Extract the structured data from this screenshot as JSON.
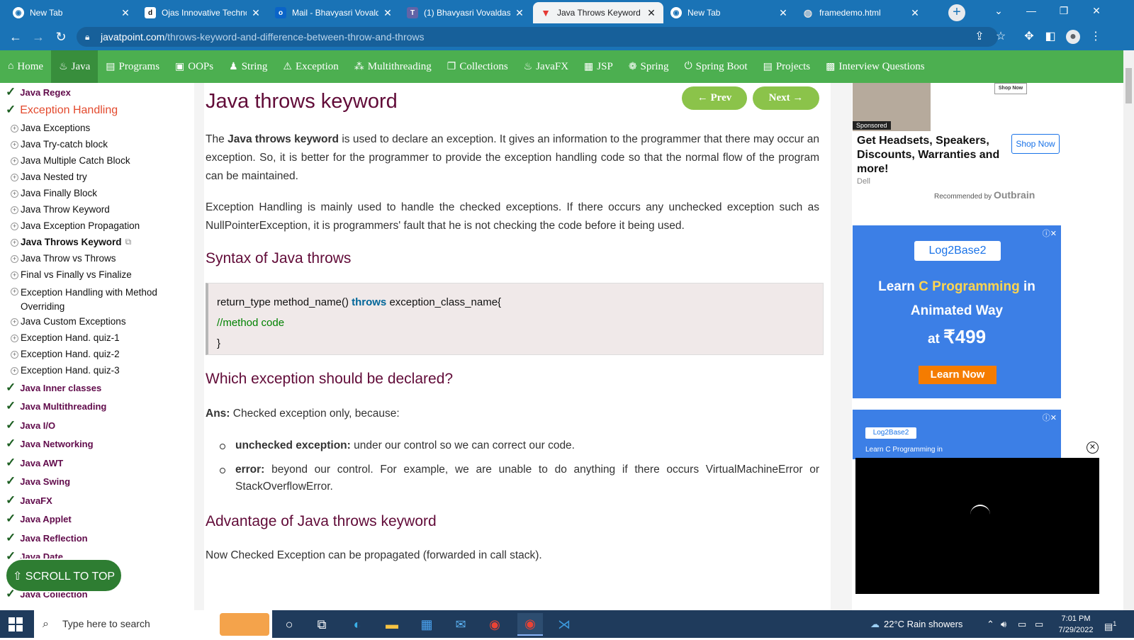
{
  "browser": {
    "tabs": [
      {
        "title": "New Tab",
        "icon": "chrome-icon"
      },
      {
        "title": "Ojas Innovative Technol",
        "icon": "d-icon"
      },
      {
        "title": "Mail - Bhavyasri Vovald",
        "icon": "outlook-icon"
      },
      {
        "title": "(1) Bhavyasri Vovaldas (",
        "icon": "teams-icon"
      },
      {
        "title": "Java Throws Keyword -",
        "icon": "javatpoint-icon"
      },
      {
        "title": "New Tab",
        "icon": "chrome-icon"
      },
      {
        "title": "framedemo.html",
        "icon": "globe-icon"
      }
    ],
    "url_domain": "javatpoint.com",
    "url_path": "/throws-keyword-and-difference-between-throw-and-throws"
  },
  "nav": {
    "items": [
      {
        "label": "Home",
        "icon": "home-icon"
      },
      {
        "label": "Java",
        "icon": "java-icon"
      },
      {
        "label": "Programs",
        "icon": "programs-icon"
      },
      {
        "label": "OOPs",
        "icon": "oops-icon"
      },
      {
        "label": "String",
        "icon": "string-icon"
      },
      {
        "label": "Exception",
        "icon": "warning-icon"
      },
      {
        "label": "Multithreading",
        "icon": "threads-icon"
      },
      {
        "label": "Collections",
        "icon": "collections-icon"
      },
      {
        "label": "JavaFX",
        "icon": "javafx-icon"
      },
      {
        "label": "JSP",
        "icon": "jsp-icon"
      },
      {
        "label": "Spring",
        "icon": "spring-icon"
      },
      {
        "label": "Spring Boot",
        "icon": "power-icon"
      },
      {
        "label": "Projects",
        "icon": "projects-icon"
      },
      {
        "label": "Interview Questions",
        "icon": "interview-icon"
      }
    ]
  },
  "sidebar": {
    "top": "Java Regex",
    "heading": "Exception Handling",
    "sub": [
      "Java Exceptions",
      "Java Try-catch block",
      "Java Multiple Catch Block",
      "Java Nested try",
      "Java Finally Block",
      "Java Throw Keyword",
      "Java Exception Propagation",
      "Java Throws Keyword",
      "Java Throw vs Throws",
      "Final vs Finally vs Finalize",
      "Exception Handling with Method Overriding",
      "Java Custom Exceptions",
      "Exception Hand. quiz-1",
      "Exception Hand. quiz-2",
      "Exception Hand. quiz-3"
    ],
    "more": [
      "Java Inner classes",
      "Java Multithreading",
      "Java I/O",
      "Java Networking",
      "Java AWT",
      "Java Swing",
      "JavaFX",
      "Java Applet",
      "Java Reflection",
      "Java Date",
      "Java Collection"
    ],
    "scroll_top": "⇧ SCROLL TO TOP"
  },
  "article": {
    "title": "Java throws keyword",
    "prev": "← Prev",
    "next": "Next →",
    "p1_pre": "The ",
    "p1_bold": "Java throws keyword",
    "p1_post": " is used to declare an exception. It gives an information to the programmer that there may occur an exception. So, it is better for the programmer to provide the exception handling code so that the normal flow of the program can be maintained.",
    "p2": "Exception Handling is mainly used to handle the checked exceptions. If there occurs any unchecked exception such as NullPointerException, it is programmers' fault that he is not checking the code before it being used.",
    "h_syntax": "Syntax of Java throws",
    "code_l1_a": "return_type method_name() ",
    "code_l1_kw": "throws",
    "code_l1_b": " exception_class_name{",
    "code_l2": "//method code",
    "code_l3": "}",
    "h_which": "Which exception should be declared?",
    "ans_label": "Ans:",
    "ans_text": " Checked exception only, because:",
    "b1_bold": "unchecked exception:",
    "b1_text": " under our control so we can correct our code.",
    "b2_bold": "error:",
    "b2_text": " beyond our control. For example, we are unable to do anything if there occurs VirtualMachineError or StackOverflowError.",
    "h_adv": "Advantage of Java throws keyword",
    "p_adv": "Now Checked Exception can be propagated (forwarded in call stack)."
  },
  "ads": {
    "sponsored": "Sponsored",
    "shop_now_small": "Shop Now",
    "ad1_title": "Get Headsets, Speakers, Discounts, Warranties and more!",
    "ad1_button": "Shop Now",
    "ad1_brand": "Dell",
    "recommended": "Recommended by",
    "outbrain": "Outbrain",
    "ad2_logo": "Log2Base2",
    "ad2_l1a": "Learn ",
    "ad2_l1b": "C Programming",
    "ad2_l1c": " in",
    "ad2_l2": "Animated Way",
    "ad2_l3a": "at ",
    "ad2_l3b": "₹499",
    "ad2_button": "Learn Now",
    "ad3_logo": "Log2Base2",
    "ad3_text": "Learn C Programming in"
  },
  "taskbar": {
    "search_placeholder": "Type here to search",
    "weather": "22°C  Rain showers",
    "time": "7:01 PM",
    "date": "7/29/2022",
    "notifications": "1"
  }
}
